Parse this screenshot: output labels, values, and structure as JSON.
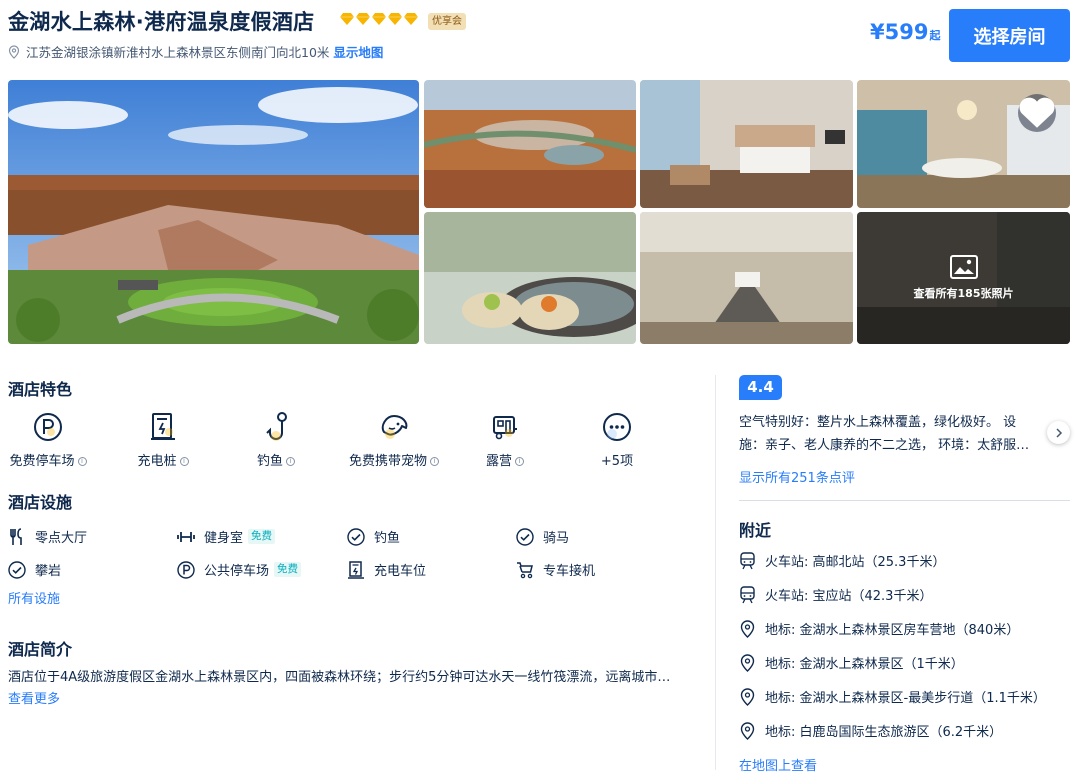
{
  "hotel": {
    "name": "金湖水上森林·港府温泉度假酒店",
    "badge": "优享会",
    "address": "江苏金湖银涂镇新淮村水上森林景区东侧南门向北10米",
    "show_map": "显示地图",
    "price": "¥599",
    "price_suffix": "起",
    "select_room": "选择房间"
  },
  "gallery": {
    "more_photos": "查看所有185张照片"
  },
  "features": {
    "title": "酒店特色",
    "items": [
      {
        "label": "免费停车场",
        "icon": "parking-icon"
      },
      {
        "label": "充电桩",
        "icon": "charging-pile-icon"
      },
      {
        "label": "钓鱼",
        "icon": "fishing-icon"
      },
      {
        "label": "免费携带宠物",
        "icon": "pet-icon"
      },
      {
        "label": "露营",
        "icon": "camping-icon"
      },
      {
        "label": "+5项",
        "icon": "more-icon"
      }
    ]
  },
  "facilities": {
    "title": "酒店设施",
    "items": [
      {
        "label": "零点大厅",
        "icon": "restaurant-icon",
        "tag": ""
      },
      {
        "label": "健身室",
        "icon": "gym-icon",
        "tag": "免费"
      },
      {
        "label": "钓鱼",
        "icon": "check-icon",
        "tag": ""
      },
      {
        "label": "骑马",
        "icon": "check-icon",
        "tag": ""
      },
      {
        "label": "攀岩",
        "icon": "check-icon",
        "tag": ""
      },
      {
        "label": "公共停车场",
        "icon": "parking-icon",
        "tag": "免费"
      },
      {
        "label": "充电车位",
        "icon": "charging-pile-icon",
        "tag": ""
      },
      {
        "label": "专车接机",
        "icon": "shuttle-icon",
        "tag": ""
      }
    ],
    "all_link": "所有设施"
  },
  "intro": {
    "title": "酒店简介",
    "text": "酒店位于4A级旅游度假区金湖水上森林景区内，四面被森林环绕；步行约5分钟可达水天一线竹筏漂流，远离城市…",
    "more_link": "查看更多"
  },
  "reviews": {
    "score": "4.4",
    "snippet": "空气特别好：整片水上森林覆盖，绿化极好。 设施：亲子、老人康养的不二之选， 环境：太舒服…",
    "all_link": "显示所有251条点评"
  },
  "nearby": {
    "title": "附近",
    "items": [
      {
        "text": "火车站: 高邮北站（25.3千米）",
        "icon": "train-icon"
      },
      {
        "text": "火车站: 宝应站（42.3千米）",
        "icon": "train-icon"
      },
      {
        "text": "地标: 金湖水上森林景区房车营地（840米）",
        "icon": "location-icon"
      },
      {
        "text": "地标: 金湖水上森林景区（1千米）",
        "icon": "location-icon"
      },
      {
        "text": "地标: 金湖水上森林景区-最美步行道（1.1千米）",
        "icon": "location-icon"
      },
      {
        "text": "地标: 白鹿岛国际生态旅游区（6.2千米）",
        "icon": "location-icon"
      }
    ],
    "map_link": "在地图上查看"
  },
  "colors": {
    "accent": "#287dfa",
    "text": "#0f294d",
    "diamond": "#f7b500",
    "free_tag": "#06aebd"
  }
}
